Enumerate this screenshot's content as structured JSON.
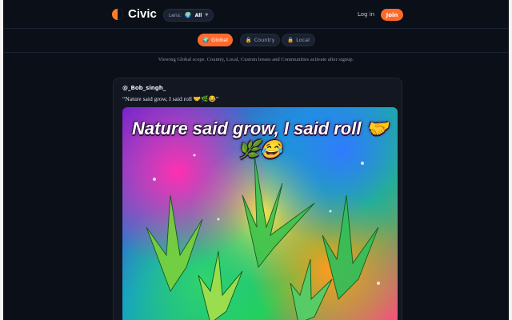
{
  "app": {
    "name": "Civic"
  },
  "header": {
    "lens_label": "Lens:",
    "lens_value": "All",
    "login_label": "Log in",
    "join_label": "Join"
  },
  "scope_tabs": [
    {
      "label": "Global",
      "icon": "globe-icon",
      "active": true
    },
    {
      "label": "Country",
      "icon": "lock-icon",
      "active": false
    },
    {
      "label": "Local",
      "icon": "lock-icon",
      "active": false
    }
  ],
  "notice": "Viewing Global scope. Country, Local, Custom lenses and Communities activate after signup.",
  "post": {
    "username": "@_Bob_singh_",
    "caption": "“Nature said grow, I said roll 🤝🌿😂”",
    "image_text": "Nature said grow, I said roll 🤝🌿😂"
  },
  "colors": {
    "accent": "#ff6a2b",
    "background": "#0b0f17",
    "card": "#121722"
  }
}
